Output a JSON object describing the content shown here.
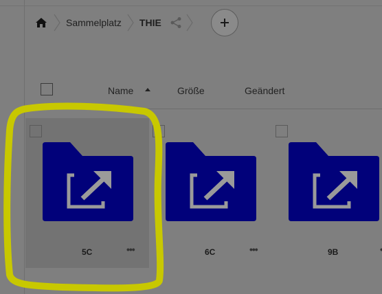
{
  "breadcrumb": {
    "items": [
      "Sammelplatz",
      "THIE"
    ]
  },
  "table_header": {
    "name": "Name",
    "size": "Größe",
    "modified": "Geändert"
  },
  "files": [
    {
      "name": "5C",
      "more": "•••",
      "selected": true
    },
    {
      "name": "6C",
      "more": "•••",
      "selected": false
    },
    {
      "name": "9B",
      "more": "•••",
      "selected": false
    }
  ],
  "colors": {
    "folder": "#01017a",
    "highlight": "#c8c800",
    "overlay_bg": "#7f7f7f"
  },
  "icons": [
    "home-icon",
    "chevron-right-icon",
    "share-icon",
    "plus-icon",
    "sort-up-icon",
    "external-link-icon",
    "more-icon"
  ]
}
